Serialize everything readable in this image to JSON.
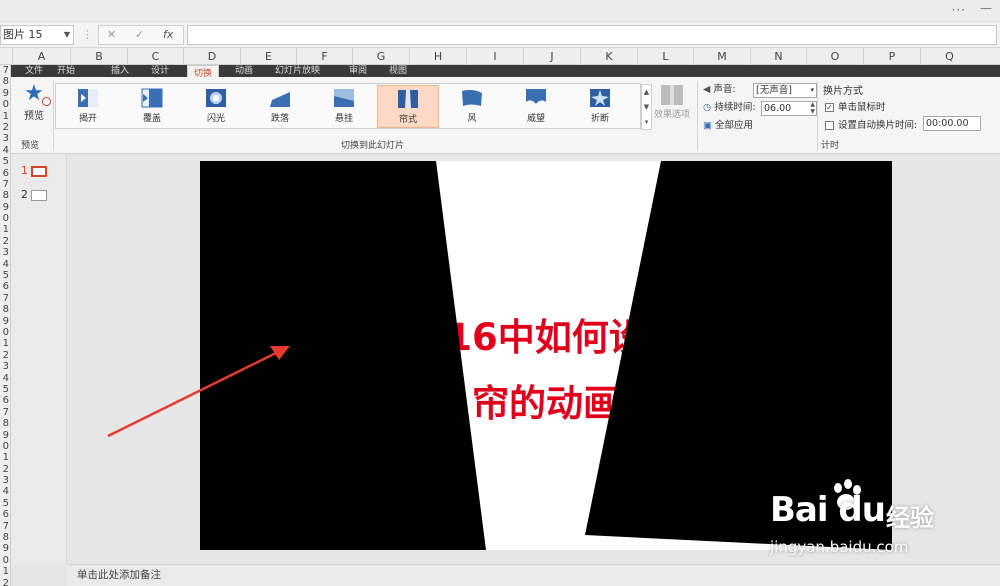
{
  "window": {
    "more_label": "···",
    "minimize_label": "—"
  },
  "formula_bar": {
    "name_box": "图片 15",
    "cancel_icon": "✕",
    "confirm_icon": "✓",
    "function_label": "fx",
    "formula_value": ""
  },
  "columns": [
    "A",
    "B",
    "C",
    "D",
    "E",
    "F",
    "G",
    "H",
    "I",
    "J",
    "K",
    "L",
    "M",
    "N",
    "O",
    "P",
    "Q"
  ],
  "rows": [
    "7",
    "8",
    "9",
    "0",
    "1",
    "2",
    "3",
    "4",
    "5",
    "6",
    "7",
    "8",
    "9",
    "0",
    "1",
    "2",
    "3",
    "4",
    "5",
    "6",
    "7",
    "8",
    "9",
    "0",
    "1",
    "2",
    "3",
    "4",
    "5",
    "6",
    "7",
    "8",
    "9",
    "0",
    "1",
    "2",
    "3",
    "4",
    "5",
    "6",
    "7",
    "8",
    "9",
    "0",
    "1",
    "2"
  ],
  "ribbon": {
    "tabs": [
      "文件",
      "开始",
      "插入",
      "设计",
      "切换",
      "动画",
      "幻灯片放映",
      "审阅",
      "视图"
    ],
    "active_tab": "切换",
    "preview": {
      "label": "预览",
      "group": "预览"
    },
    "transitions": {
      "group": "切换到此幻灯片",
      "items": [
        {
          "label": "揭开",
          "icon": "uncover-icon"
        },
        {
          "label": "覆盖",
          "icon": "cover-icon"
        },
        {
          "label": "闪光",
          "icon": "flash-icon"
        },
        {
          "label": "跌落",
          "icon": "fall-over-icon"
        },
        {
          "label": "悬挂",
          "icon": "drape-icon"
        },
        {
          "label": "帘式",
          "icon": "curtains-icon",
          "selected": true
        },
        {
          "label": "风",
          "icon": "wind-icon"
        },
        {
          "label": "威望",
          "icon": "prestige-icon"
        },
        {
          "label": "折断",
          "icon": "fracture-icon"
        }
      ],
      "effect_options": "效果选项"
    },
    "timing": {
      "sound_label": "声音:",
      "sound_value": "[无声音]",
      "duration_label": "持续时间:",
      "duration_value": "06.00",
      "apply_all": "全部应用",
      "group": "计时"
    },
    "advance": {
      "title": "换片方式",
      "on_click_label": "单击鼠标时",
      "on_click_checked": true,
      "after_label": "设置自动换片时间:",
      "after_checked": false,
      "after_value": "00:00.00"
    }
  },
  "thumbnails": [
    {
      "number": "1",
      "selected": true
    },
    {
      "number": "2",
      "selected": false
    }
  ],
  "slide": {
    "line1": "16中如何设",
    "line2": "帘的动画"
  },
  "notes_placeholder": "单击此处添加备注",
  "watermark": {
    "brand": "Bai du",
    "cn": "经验",
    "url": "jingyan.baidu.com"
  },
  "colors": {
    "accent": "#d24726",
    "slide_title": "#e0001b",
    "arrow": "#e8392f"
  }
}
